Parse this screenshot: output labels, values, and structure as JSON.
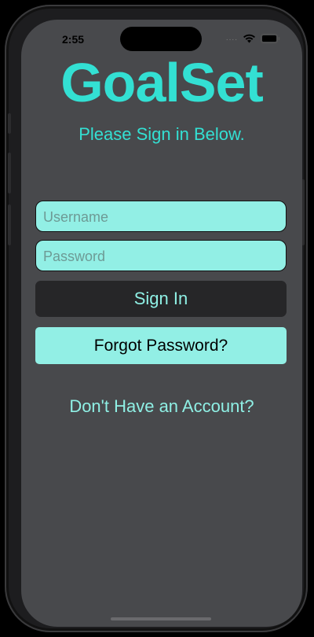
{
  "status_bar": {
    "time": "2:55",
    "signal": "....",
    "wifi_icon": "wifi-icon",
    "battery_icon": "battery-icon"
  },
  "app": {
    "title": "GoalSet",
    "subtitle": "Please Sign in Below."
  },
  "form": {
    "username_placeholder": "Username",
    "username_value": "",
    "password_placeholder": "Password",
    "password_value": ""
  },
  "buttons": {
    "sign_in": "Sign In",
    "forgot_password": "Forgot Password?"
  },
  "links": {
    "no_account": "Don't Have an Account?"
  },
  "colors": {
    "accent": "#33e0d3",
    "field_bg": "#92efe5",
    "screen_bg": "#48494c",
    "dark_button": "#262628"
  }
}
